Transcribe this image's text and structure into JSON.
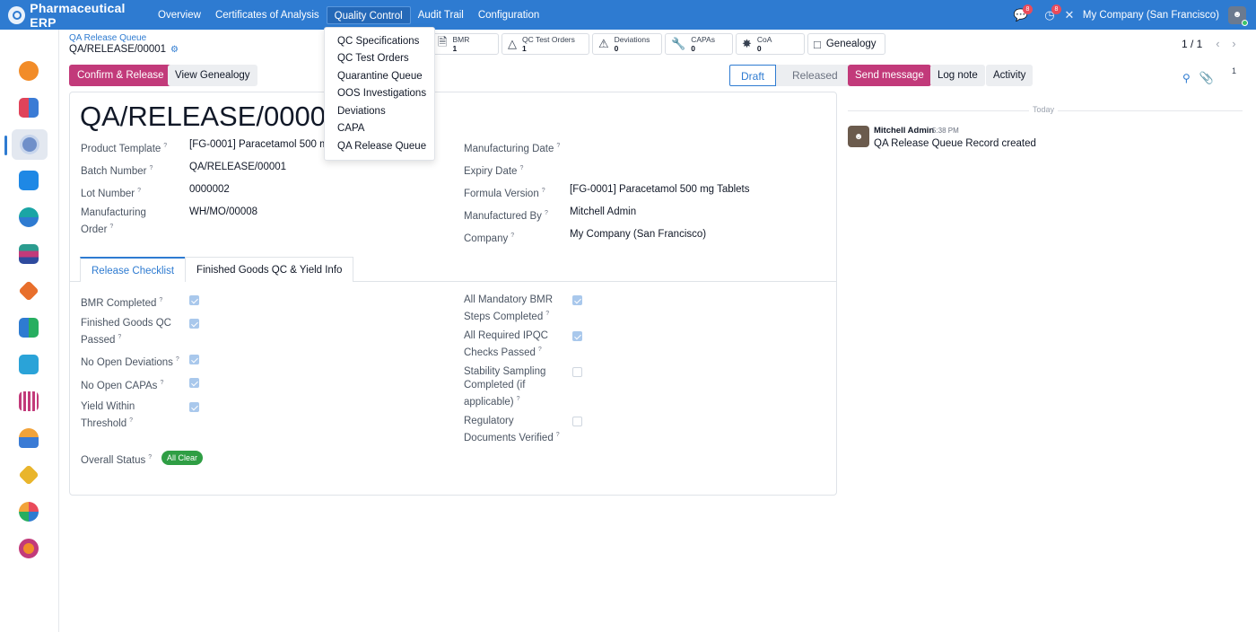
{
  "navbar": {
    "brand": "Pharmaceutical ERP",
    "menu": [
      "Overview",
      "Certificates of Analysis",
      "Quality Control",
      "Audit Trail",
      "Configuration"
    ],
    "active_menu": "Quality Control",
    "messages_badge": "8",
    "activities_badge": "8",
    "company": "My Company (San Francisco)",
    "brand_color": "#2e7bd1"
  },
  "breadcrumb": {
    "parent": "QA Release Queue",
    "record": "QA/RELEASE/00001"
  },
  "actions": {
    "confirm_label": "Confirm & Release",
    "genealogy_label": "View Genealogy"
  },
  "smart_buttons": [
    {
      "label": "BMR",
      "count": "1",
      "icon": "document-icon"
    },
    {
      "label": "QC Test Orders",
      "count": "1",
      "icon": "flask-icon"
    },
    {
      "label": "Deviations",
      "count": "0",
      "icon": "warning-icon"
    },
    {
      "label": "CAPAs",
      "count": "0",
      "icon": "wrench-icon"
    },
    {
      "label": "CoA",
      "count": "0",
      "icon": "certificate-icon"
    },
    {
      "label": "Genealogy",
      "icon": "sitemap-icon"
    }
  ],
  "pager": "1 / 1",
  "status": {
    "stages": [
      "Draft",
      "Released"
    ],
    "current": "Draft"
  },
  "form": {
    "title": "QA/RELEASE/00001",
    "left_fields": [
      {
        "label": "Product Template",
        "value": "[FG-0001] Paracetamol 500 m"
      },
      {
        "label": "Batch Number",
        "value": "QA/RELEASE/00001"
      },
      {
        "label": "Lot Number",
        "value": "0000002"
      },
      {
        "label": "Manufacturing Order",
        "value": "WH/MO/00008"
      }
    ],
    "right_fields": [
      {
        "label": "Manufacturing Date",
        "value": ""
      },
      {
        "label": "Expiry Date",
        "value": ""
      },
      {
        "label": "Formula Version",
        "value": "[FG-0001] Paracetamol 500 mg Tablets"
      },
      {
        "label": "Manufactured By",
        "value": "Mitchell Admin"
      },
      {
        "label": "Company",
        "value": "My Company (San Francisco)"
      }
    ],
    "tabs": [
      "Release Checklist",
      "Finished Goods QC & Yield Info"
    ],
    "active_tab": "Release Checklist",
    "checklist_left": [
      {
        "label": "BMR Completed",
        "checked": true
      },
      {
        "label": "Finished Goods QC Passed",
        "checked": true
      },
      {
        "label": "No Open Deviations",
        "checked": true
      },
      {
        "label": "No Open CAPAs",
        "checked": true
      },
      {
        "label": "Yield Within Threshold",
        "checked": true
      }
    ],
    "checklist_right": [
      {
        "label": "All Mandatory BMR Steps Completed",
        "checked": true
      },
      {
        "label": "All Required IPQC Checks Passed",
        "checked": true
      },
      {
        "label": "Stability Sampling Completed (if applicable)",
        "checked": false
      },
      {
        "label": "Regulatory Documents Verified",
        "checked": false
      }
    ],
    "overall_status_label": "Overall Status",
    "overall_status_value": "All Clear",
    "help_mark": "?"
  },
  "dropdown": {
    "items": [
      "QC Specifications",
      "QC Test Orders",
      "Quarantine Queue",
      "OOS Investigations",
      "Deviations",
      "CAPA",
      "QA Release Queue"
    ]
  },
  "chatter": {
    "send_message": "Send message",
    "log_note": "Log note",
    "activity": "Activity",
    "attachments_count": "1",
    "today_label": "Today",
    "author": "Mitchell Admin",
    "time": "5:38 PM",
    "body": "QA Release Queue Record created"
  }
}
